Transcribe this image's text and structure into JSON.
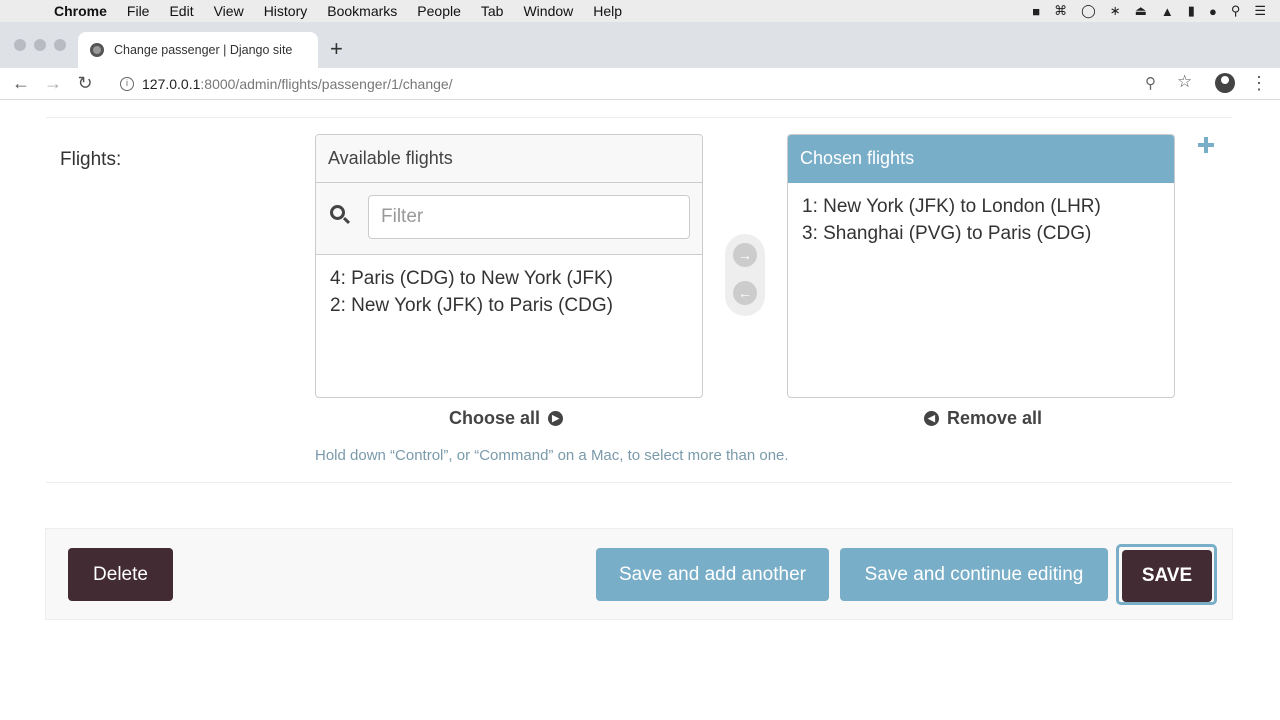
{
  "menubar": {
    "app": "Chrome",
    "items": [
      "File",
      "Edit",
      "View",
      "History",
      "Bookmarks",
      "People",
      "Tab",
      "Window",
      "Help"
    ]
  },
  "tab": {
    "title": "Change passenger | Django site"
  },
  "address": {
    "host": "127.0.0.1",
    "path": ":8000/admin/flights/passenger/1/change/"
  },
  "form": {
    "field_label": "Flights:",
    "available": {
      "title": "Available flights",
      "filter_placeholder": "Filter",
      "options": [
        "4: Paris (CDG) to New York (JFK)",
        "2: New York (JFK) to Paris (CDG)"
      ]
    },
    "chosen": {
      "title": "Chosen flights",
      "options": [
        "1: New York (JFK) to London (LHR)",
        "3: Shanghai (PVG) to Paris (CDG)"
      ]
    },
    "choose_all": "Choose all",
    "remove_all": "Remove all",
    "help_text": "Hold down “Control”, or “Command” on a Mac, to select more than one."
  },
  "submit": {
    "delete": "Delete",
    "save_add_another": "Save and add another",
    "save_continue": "Save and continue editing",
    "save": "SAVE"
  },
  "colors": {
    "accent": "#79aec8",
    "dark_button": "#432b33"
  }
}
